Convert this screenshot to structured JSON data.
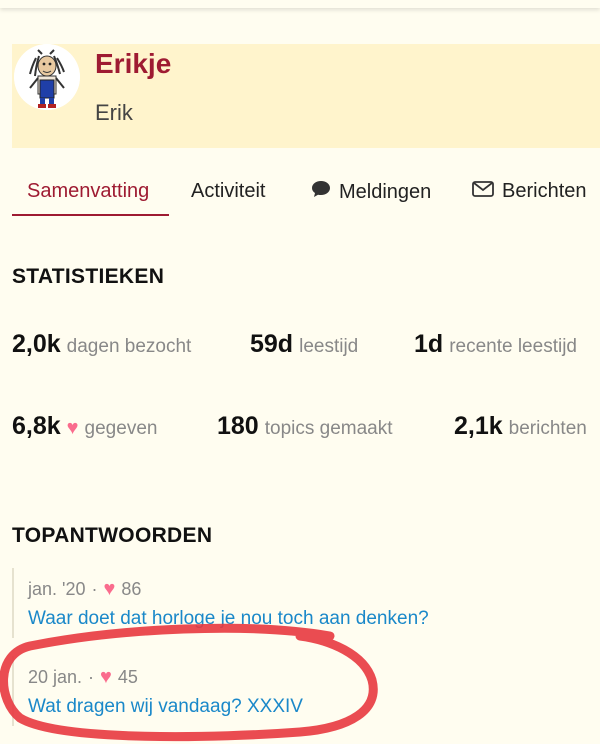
{
  "profile": {
    "username": "Erikje",
    "full_name": "Erik"
  },
  "tabs": [
    {
      "label": "Samenvatting",
      "icon": "",
      "active": true
    },
    {
      "label": "Activiteit",
      "icon": "",
      "active": false
    },
    {
      "label": "Meldingen",
      "icon": "speech-bubble-icon",
      "active": false
    },
    {
      "label": "Berichten",
      "icon": "envelope-icon",
      "active": false
    }
  ],
  "stats": {
    "title": "STATISTIEKEN",
    "items": [
      {
        "value": "2,0k",
        "label": "dagen bezocht"
      },
      {
        "value": "59d",
        "label": "leestijd"
      },
      {
        "value": "1d",
        "label": "recente leestijd"
      },
      {
        "value": "6,8k",
        "label": "gegeven",
        "icon": "heart-icon"
      },
      {
        "value": "180",
        "label": "topics gemaakt"
      },
      {
        "value": "2,1k",
        "label": "berichten"
      }
    ]
  },
  "top_replies": {
    "title": "TOPANTWOORDEN",
    "items": [
      {
        "date": "jan. '20",
        "separator": "·",
        "likes": "86",
        "title": "Waar doet dat horloge je nou toch aan denken?"
      },
      {
        "date": "20 jan.",
        "separator": "·",
        "likes": "45",
        "title": "Wat dragen wij vandaag? XXXIV"
      }
    ]
  },
  "colors": {
    "accent": "#9e1b32",
    "link": "#1a88c9",
    "heart": "#fa6c8d",
    "annotation": "#e8383f"
  }
}
